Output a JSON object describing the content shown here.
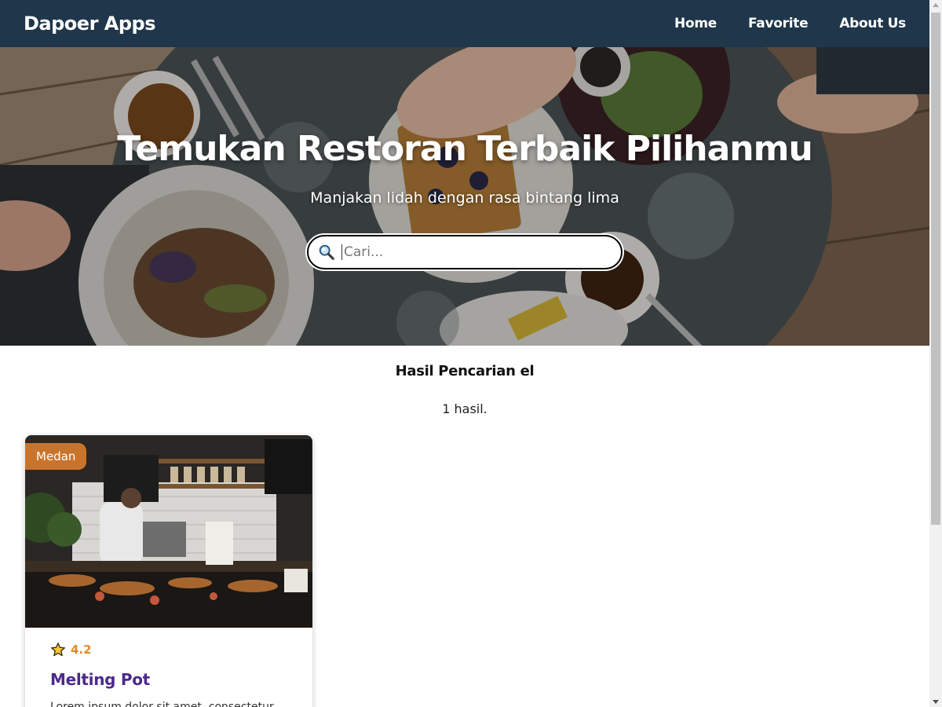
{
  "header": {
    "brand": "Dapoer Apps",
    "nav": [
      {
        "label": "Home"
      },
      {
        "label": "Favorite"
      },
      {
        "label": "About Us"
      }
    ],
    "background_color": "#1f364b"
  },
  "hero": {
    "title": "Temukan Restoran Terbaik Pilihanmu",
    "subtitle": "Manjakan lidah dengan rasa bintang lima",
    "search": {
      "placeholder": "Cari...",
      "value": "",
      "icon": "search-icon"
    }
  },
  "results": {
    "heading": "Hasil Pencarian el",
    "count": "1 hasil."
  },
  "restaurants": [
    {
      "city": "Medan",
      "rating": "4.2",
      "name": "Melting Pot",
      "description": "Lorem ipsum dolor sit amet, consectetur",
      "badge_color": "#c9742d",
      "title_color": "#4b2a8a",
      "rating_color": "#e08a2c"
    }
  ]
}
